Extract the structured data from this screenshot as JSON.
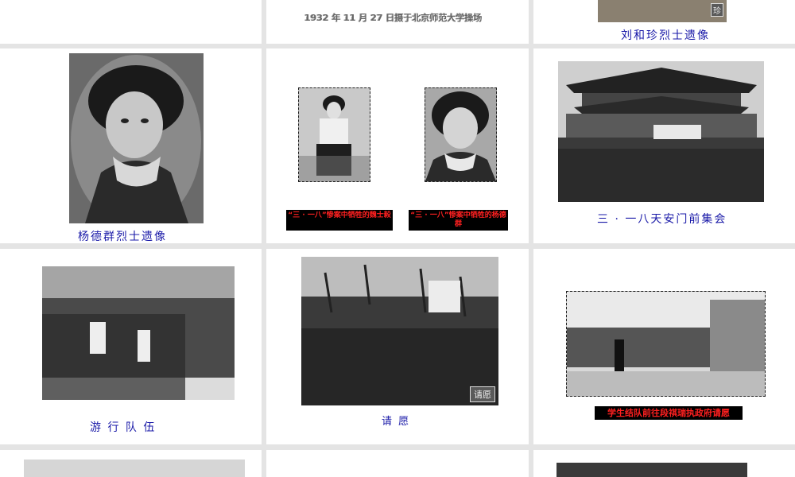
{
  "top": {
    "date_caption": "1932 年 11 月 27 日摄于北京师范大学操场",
    "liu_caption": "刘和珍烈士遗像",
    "liu_stamp": "珍"
  },
  "row1": {
    "yang_caption": "杨德群烈士遗像",
    "wei_caption": "“三 · 一八”惨案中牺牲的魏士毅",
    "yang2_caption": "“三 · 一八”惨案中牺牲的杨德群",
    "tiananmen_caption": "三 · 一八天安门前集会"
  },
  "row2": {
    "parade_caption": "游 行 队 伍",
    "petition_caption": "请 愿",
    "petition_stamp": "请愿",
    "students_caption": "学生结队前往段祺瑞执政府请愿"
  }
}
